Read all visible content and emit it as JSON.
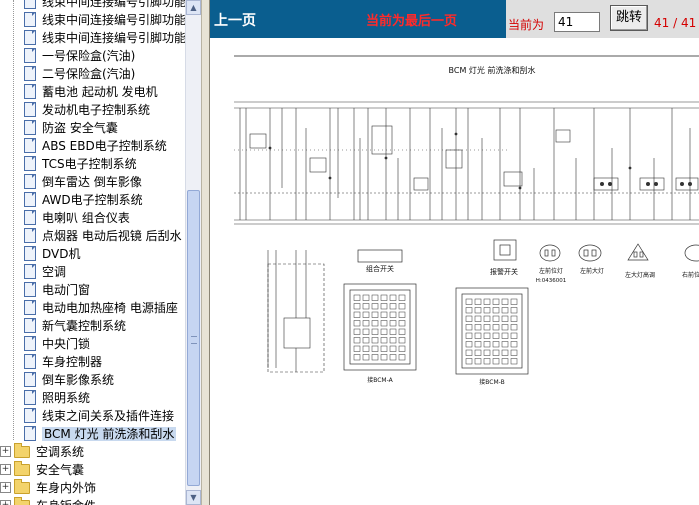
{
  "tree": {
    "items": [
      {
        "label": "线束中间连接编号引脚功能",
        "type": "doc"
      },
      {
        "label": "线束中间连接编号引脚功能",
        "type": "doc"
      },
      {
        "label": "线束中间连接编号引脚功能",
        "type": "doc"
      },
      {
        "label": "一号保险盒(汽油)",
        "type": "doc"
      },
      {
        "label": "二号保险盒(汽油)",
        "type": "doc"
      },
      {
        "label": "蓄电池  起动机  发电机",
        "type": "doc"
      },
      {
        "label": "发动机电子控制系统",
        "type": "doc"
      },
      {
        "label": "防盗  安全气囊",
        "type": "doc"
      },
      {
        "label": "ABS EBD电子控制系统",
        "type": "doc"
      },
      {
        "label": "TCS电子控制系统",
        "type": "doc"
      },
      {
        "label": "倒车雷达  倒车影像",
        "type": "doc"
      },
      {
        "label": "AWD电子控制系统",
        "type": "doc"
      },
      {
        "label": "电喇叭  组合仪表",
        "type": "doc"
      },
      {
        "label": "点烟器  电动后视镜  后刮水",
        "type": "doc"
      },
      {
        "label": "DVD机",
        "type": "doc"
      },
      {
        "label": "空调",
        "type": "doc"
      },
      {
        "label": "电动门窗",
        "type": "doc"
      },
      {
        "label": "电动电加热座椅  电源插座",
        "type": "doc"
      },
      {
        "label": "新气囊控制系统",
        "type": "doc"
      },
      {
        "label": "中央门锁",
        "type": "doc"
      },
      {
        "label": "车身控制器",
        "type": "doc"
      },
      {
        "label": "倒车影像系统",
        "type": "doc"
      },
      {
        "label": "照明系统",
        "type": "doc"
      },
      {
        "label": "线束之间关系及插件连接",
        "type": "doc"
      },
      {
        "label": "BCM 灯光  前洗涤和刮水",
        "type": "doc",
        "selected": true
      }
    ],
    "folders": [
      {
        "label": "空调系统"
      },
      {
        "label": "安全气囊"
      },
      {
        "label": "车身内外饰"
      },
      {
        "label": "车身钣金件"
      }
    ]
  },
  "toolbar": {
    "prev_label": "上一页",
    "last_page_msg": "当前为最后一页",
    "current_label": "当前为",
    "page_value": "41",
    "jump_label": "跳转",
    "page_count": "41 / 41"
  },
  "diagram": {
    "title": "BCM 灯光  前洗涤和刮水",
    "labels": {
      "combo_switch": "组合开关",
      "hazard_switch": "报警开关",
      "left_front_position": "左前位灯",
      "left_front_position_code": "H:0436001",
      "left_front_headlamp": "左前大灯",
      "left_headlamp_adjust": "左大灯高调",
      "right_front_position": "右前位灯",
      "bcm_a": "接BCM-A",
      "bcm_b": "接BCM-B"
    }
  },
  "colors": {
    "topbar": "#0a5e8f",
    "alert_red": "#ff2a2a",
    "selected_bg": "#c8d9ef"
  }
}
